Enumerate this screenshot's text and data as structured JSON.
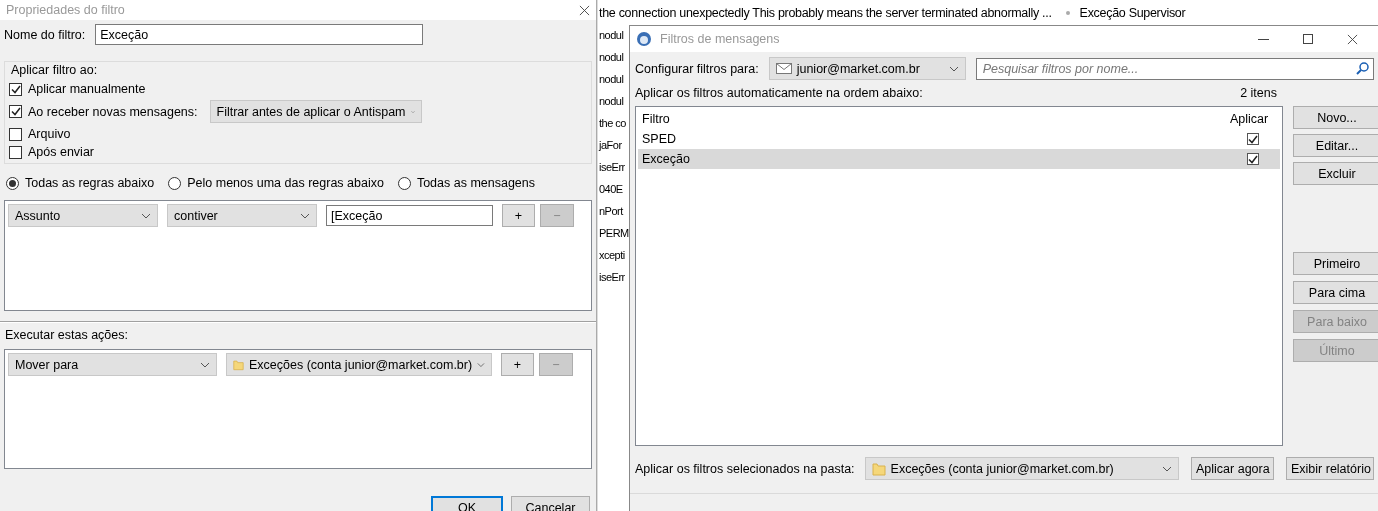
{
  "background_window": {
    "rows": [
      {
        "column_1": "the connection unexpectedly This probably means the server terminated abnormally ...",
        "column_2": "Exceção Supervisor"
      },
      {
        "column_1": "nodul"
      },
      {
        "column_1": "nodul"
      },
      {
        "column_1": "nodul"
      },
      {
        "column_1": "nodul"
      },
      {
        "column_1": "the co"
      },
      {
        "column_1": "jaFor"
      },
      {
        "column_1": "iseErr"
      },
      {
        "column_1": "040E"
      },
      {
        "column_1": "nPort"
      },
      {
        "column_1": "PERM"
      },
      {
        "column_1": "xcepti"
      },
      {
        "column_1": "iseErr"
      }
    ]
  },
  "filter_properties": {
    "title": "Propriedades do filtro",
    "name_label": "Nome do filtro:",
    "name_value": "Exceção",
    "apply_group": {
      "title": "Aplicar filtro ao:",
      "options": [
        {
          "kind": "plain",
          "label": "Aplicar manualmente",
          "checked": true
        },
        {
          "kind": "with_select",
          "label": "Ao receber novas mensagens:",
          "checked": true,
          "select": "Filtrar antes de aplicar o Antispam"
        },
        {
          "kind": "plain",
          "label": "Arquivo",
          "checked": false
        },
        {
          "kind": "plain",
          "label": "Após enviar",
          "checked": false
        }
      ]
    },
    "match": [
      {
        "label": "Todas as regras abaixo",
        "selected": true
      },
      {
        "label": "Pelo menos uma das regras abaixo",
        "selected": false
      },
      {
        "label": "Todas as mensagens",
        "selected": false
      }
    ],
    "rules": [
      {
        "field": "Assunto",
        "operator": "contiver",
        "value": "[Exceção",
        "add": "+",
        "remove": "−",
        "remove_disabled": true
      }
    ],
    "actions_label": "Executar estas ações:",
    "actions": [
      {
        "action": "Mover para",
        "target": "Exceções (conta junior@market.com.br)",
        "add": "+",
        "remove": "−",
        "remove_disabled": true
      }
    ],
    "buttons": [
      {
        "label": "OK",
        "default": true
      },
      {
        "label": "Cancelar",
        "default": false
      }
    ]
  },
  "message_filters": {
    "title": "Filtros de mensagens",
    "account_label": "Configurar filtros para:",
    "account": "junior@market.com.br",
    "search_placeholder": "Pesquisar filtros por nome...",
    "list_label": "Aplicar os filtros automaticamente na ordem abaixo:",
    "count": "2 itens",
    "columns": [
      "Filtro",
      "Aplicar"
    ],
    "rows": [
      {
        "name": "SPED",
        "enabled": true,
        "selected": false
      },
      {
        "name": "Exceção",
        "enabled": true,
        "selected": true
      }
    ],
    "edit_buttons": [
      {
        "label": "Novo...",
        "disabled": false
      },
      {
        "label": "Editar...",
        "disabled": false
      },
      {
        "label": "Excluir",
        "disabled": false
      }
    ],
    "order_buttons": [
      {
        "label": "Primeiro",
        "disabled": false
      },
      {
        "label": "Para cima",
        "disabled": false
      },
      {
        "label": "Para baixo",
        "disabled": true
      },
      {
        "label": "Último",
        "disabled": true
      }
    ],
    "folder_label": "Aplicar os filtros selecionados na pasta:",
    "folder": "Exceções (conta junior@market.com.br)",
    "apply_button": "Aplicar agora",
    "log_button": "Exibir relatório"
  }
}
